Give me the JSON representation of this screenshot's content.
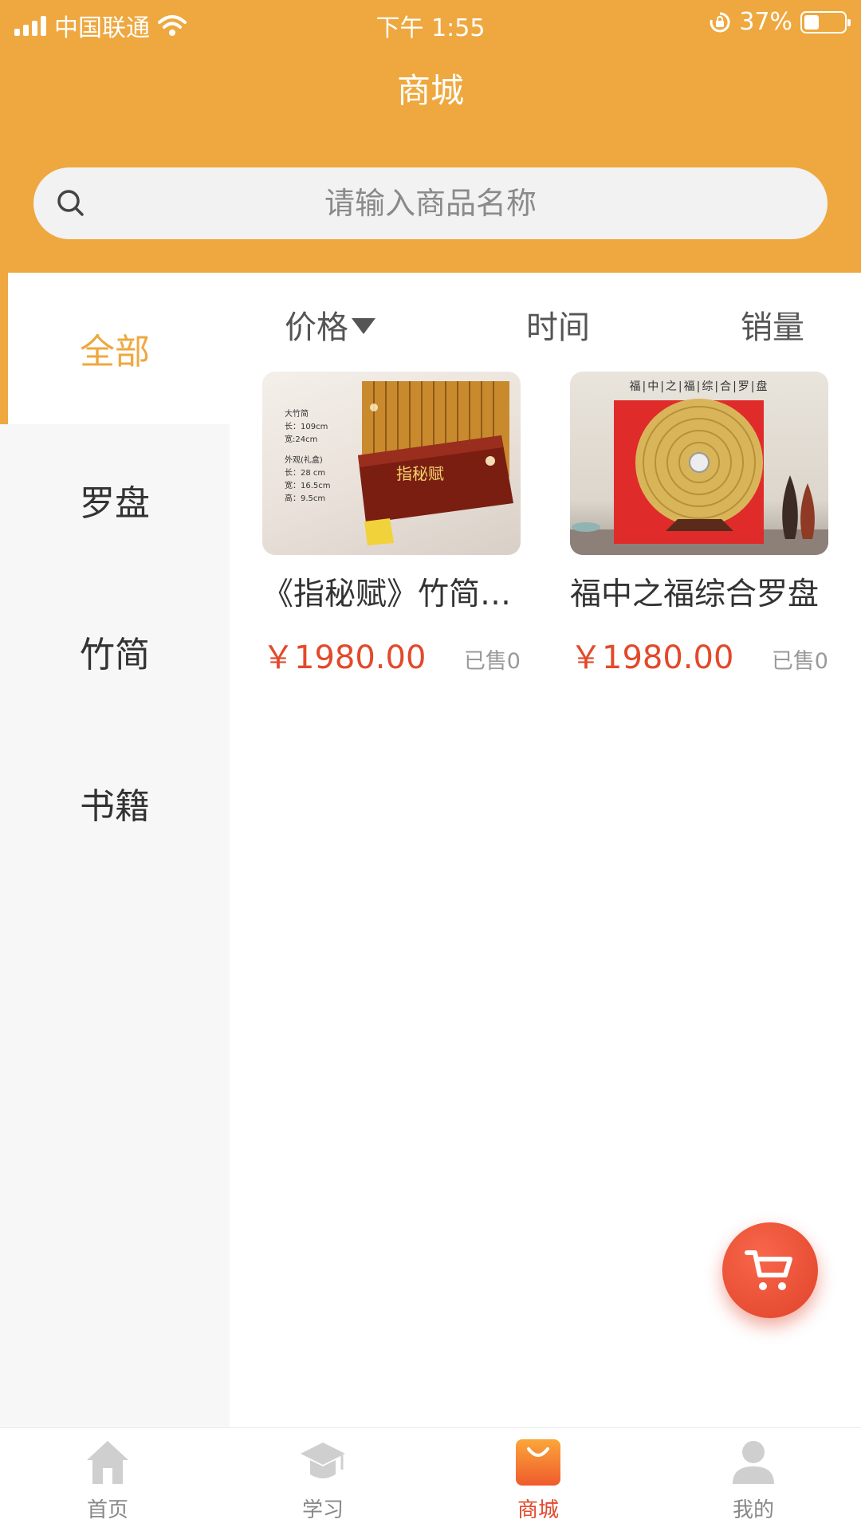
{
  "status_bar": {
    "carrier": "中国联通",
    "time": "下午 1:55",
    "battery": "37%",
    "battery_level": 0.37
  },
  "header": {
    "title": "商城",
    "accent_color": "#EEA83F"
  },
  "search": {
    "placeholder": "请输入商品名称",
    "icon": "search-icon"
  },
  "categories": [
    {
      "label": "全部",
      "active": true
    },
    {
      "label": "罗盘",
      "active": false
    },
    {
      "label": "竹简",
      "active": false
    },
    {
      "label": "书籍",
      "active": false
    }
  ],
  "sort": {
    "price": "价格",
    "time": "时间",
    "sales": "销量"
  },
  "products": [
    {
      "name": "《指秘赋》竹简…",
      "price": "￥1980.00",
      "sold": "已售0",
      "image": {
        "title": "指秘赋",
        "spec_lines": [
          "大竹简",
          "长：109cm",
          "宽:24cm",
          "外观(礼盒)",
          "长：28 cm",
          "宽：16.5cm",
          "高：9.5cm"
        ]
      }
    },
    {
      "name": "福中之福综合罗盘",
      "price": "￥1980.00",
      "sold": "已售0",
      "image": {
        "title": "福|中|之|福|综|合|罗|盘"
      }
    }
  ],
  "fab": {
    "icon": "shopping-cart-icon",
    "color": "#E3492B"
  },
  "tabbar": [
    {
      "label": "首页",
      "icon": "home-icon",
      "active": false
    },
    {
      "label": "学习",
      "icon": "graduation-cap-icon",
      "active": false
    },
    {
      "label": "商城",
      "icon": "shopping-bag-icon",
      "active": true
    },
    {
      "label": "我的",
      "icon": "user-icon",
      "active": false
    }
  ]
}
